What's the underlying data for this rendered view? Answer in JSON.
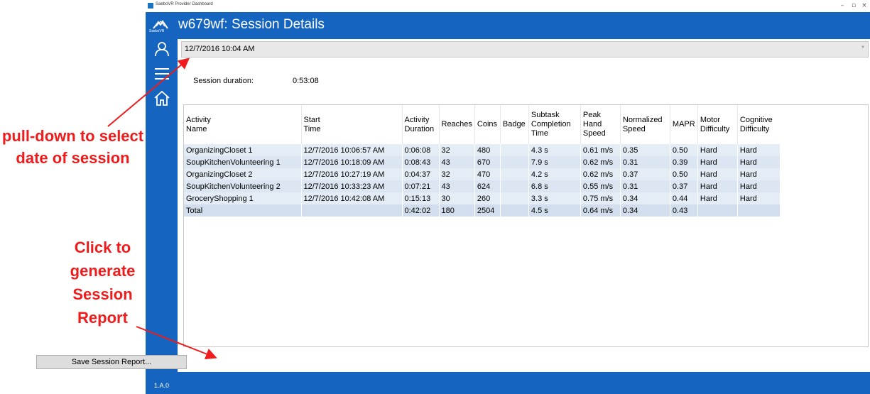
{
  "annotations": {
    "pulldown_text": "pull-down to select date of session",
    "report_text": "Click to generate Session Report"
  },
  "window": {
    "title": "SaeboVR Provider Dashboard",
    "controls": [
      "–",
      "▫",
      "×"
    ]
  },
  "header": {
    "logo_text": "SaeboVR",
    "title": "w679wf: Session Details"
  },
  "sidebar": {
    "items": [
      {
        "name": "user-icon"
      },
      {
        "name": "menu-icon"
      },
      {
        "name": "home-icon"
      }
    ],
    "version": "1.A.0"
  },
  "session": {
    "selected_date": "12/7/2016 10:04 AM",
    "duration_label": "Session duration:",
    "duration_value": "0:53:08"
  },
  "table": {
    "columns": [
      [
        "Activity",
        "Name"
      ],
      [
        "Start",
        "Time"
      ],
      [
        "Activity",
        "Duration"
      ],
      [
        "Reaches"
      ],
      [
        "Coins"
      ],
      [
        "Badge"
      ],
      [
        "Subtask",
        "Completion",
        "Time"
      ],
      [
        "Peak",
        "Hand",
        "Speed"
      ],
      [
        "Normalized",
        "Speed"
      ],
      [
        "MAPR"
      ],
      [
        "Motor",
        "Difficulty"
      ],
      [
        "Cognitive",
        "Difficulty"
      ]
    ],
    "rows": [
      [
        "OrganizingCloset 1",
        "12/7/2016 10:06:57 AM",
        "0:06:08",
        "32",
        "480",
        "",
        "4.3 s",
        "0.61 m/s",
        "0.35",
        "0.50",
        "Hard",
        "Hard"
      ],
      [
        "SoupKitchenVolunteering 1",
        "12/7/2016 10:18:09 AM",
        "0:08:43",
        "43",
        "670",
        "",
        "7.9 s",
        "0.62 m/s",
        "0.31",
        "0.39",
        "Hard",
        "Hard"
      ],
      [
        "OrganizingCloset 2",
        "12/7/2016 10:27:19 AM",
        "0:04:37",
        "32",
        "470",
        "",
        "4.2 s",
        "0.62 m/s",
        "0.37",
        "0.50",
        "Hard",
        "Hard"
      ],
      [
        "SoupKitchenVolunteering 2",
        "12/7/2016 10:33:23 AM",
        "0:07:21",
        "43",
        "624",
        "",
        "6.8 s",
        "0.55 m/s",
        "0.31",
        "0.37",
        "Hard",
        "Hard"
      ],
      [
        "GroceryShopping 1",
        "12/7/2016 10:42:08 AM",
        "0:15:13",
        "30",
        "260",
        "",
        "3.3 s",
        "0.75 m/s",
        "0.34",
        "0.44",
        "Hard",
        "Hard"
      ],
      [
        "Total",
        "",
        "0:42:02",
        "180",
        "2504",
        "",
        "4.5 s",
        "0.64 m/s",
        "0.34",
        "0.43",
        "",
        ""
      ]
    ]
  },
  "footer": {
    "save_label": "Save Session Report..."
  },
  "colors": {
    "brand_blue": "#1565c0",
    "annotation_red": "#ee1c1c",
    "row_bg": "#dce6f2"
  }
}
